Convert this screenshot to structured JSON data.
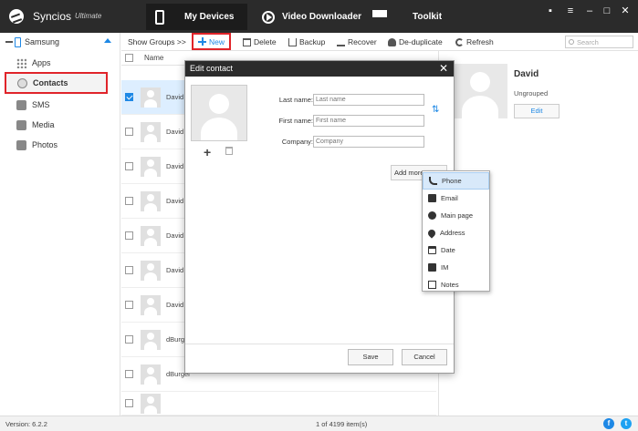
{
  "app": {
    "name": "Syncios",
    "edition": "Ultimate"
  },
  "nav": {
    "tabs": [
      {
        "label": "My Devices"
      },
      {
        "label": "Video Downloader"
      },
      {
        "label": "Toolkit"
      }
    ]
  },
  "window_controls": [
    "chat",
    "menu",
    "minimize",
    "maximize",
    "close"
  ],
  "sidebar": {
    "device": "Samsung",
    "items": [
      {
        "label": "Apps"
      },
      {
        "label": "Contacts"
      },
      {
        "label": "SMS"
      },
      {
        "label": "Media"
      },
      {
        "label": "Photos"
      }
    ]
  },
  "toolbar": {
    "show_groups": "Show Groups >>",
    "new": "New",
    "delete": "Delete",
    "backup": "Backup",
    "recover": "Recover",
    "deduplicate": "De-duplicate",
    "refresh": "Refresh",
    "search_placeholder": "Search"
  },
  "list": {
    "header_name": "Name",
    "rows": [
      {
        "name": "David",
        "selected": true
      },
      {
        "name": "David E",
        "selected": false
      },
      {
        "name": "David E",
        "selected": false
      },
      {
        "name": "David E",
        "selected": false
      },
      {
        "name": "David E",
        "selected": false
      },
      {
        "name": "David S",
        "selected": false
      },
      {
        "name": "David V",
        "selected": false
      },
      {
        "name": "dBurger",
        "selected": false
      },
      {
        "name": "dBurger",
        "selected": false
      },
      {
        "name": "",
        "selected": false
      }
    ]
  },
  "detail": {
    "name": "David",
    "group": "Ungrouped",
    "edit": "Edit"
  },
  "dialog": {
    "title": "Edit contact",
    "close": "✕",
    "add_photo": "+",
    "last_name_label": "Last name:",
    "last_name_placeholder": "Last name",
    "first_name_label": "First name:",
    "first_name_placeholder": "First name",
    "company_label": "Company:",
    "company_placeholder": "Company",
    "add_more": "Add more",
    "save": "Save",
    "cancel": "Cancel"
  },
  "add_more_menu": {
    "items": [
      {
        "label": "Phone",
        "icon": "phone-icon",
        "highlighted": true
      },
      {
        "label": "Email",
        "icon": "email-icon"
      },
      {
        "label": "Main page",
        "icon": "globe-icon"
      },
      {
        "label": "Address",
        "icon": "location-pin-icon"
      },
      {
        "label": "Date",
        "icon": "calendar-icon"
      },
      {
        "label": "IM",
        "icon": "im-icon"
      },
      {
        "label": "Notes",
        "icon": "notes-icon"
      }
    ]
  },
  "status": {
    "version": "Version: 6.2.2",
    "count": "1 of 4199 item(s)"
  },
  "colors": {
    "titlebar": "#2b2b2b",
    "accent": "#1e88e5",
    "highlight_box": "#e0242a",
    "facebook": "#1e88e5",
    "twitter": "#1da1f2"
  }
}
